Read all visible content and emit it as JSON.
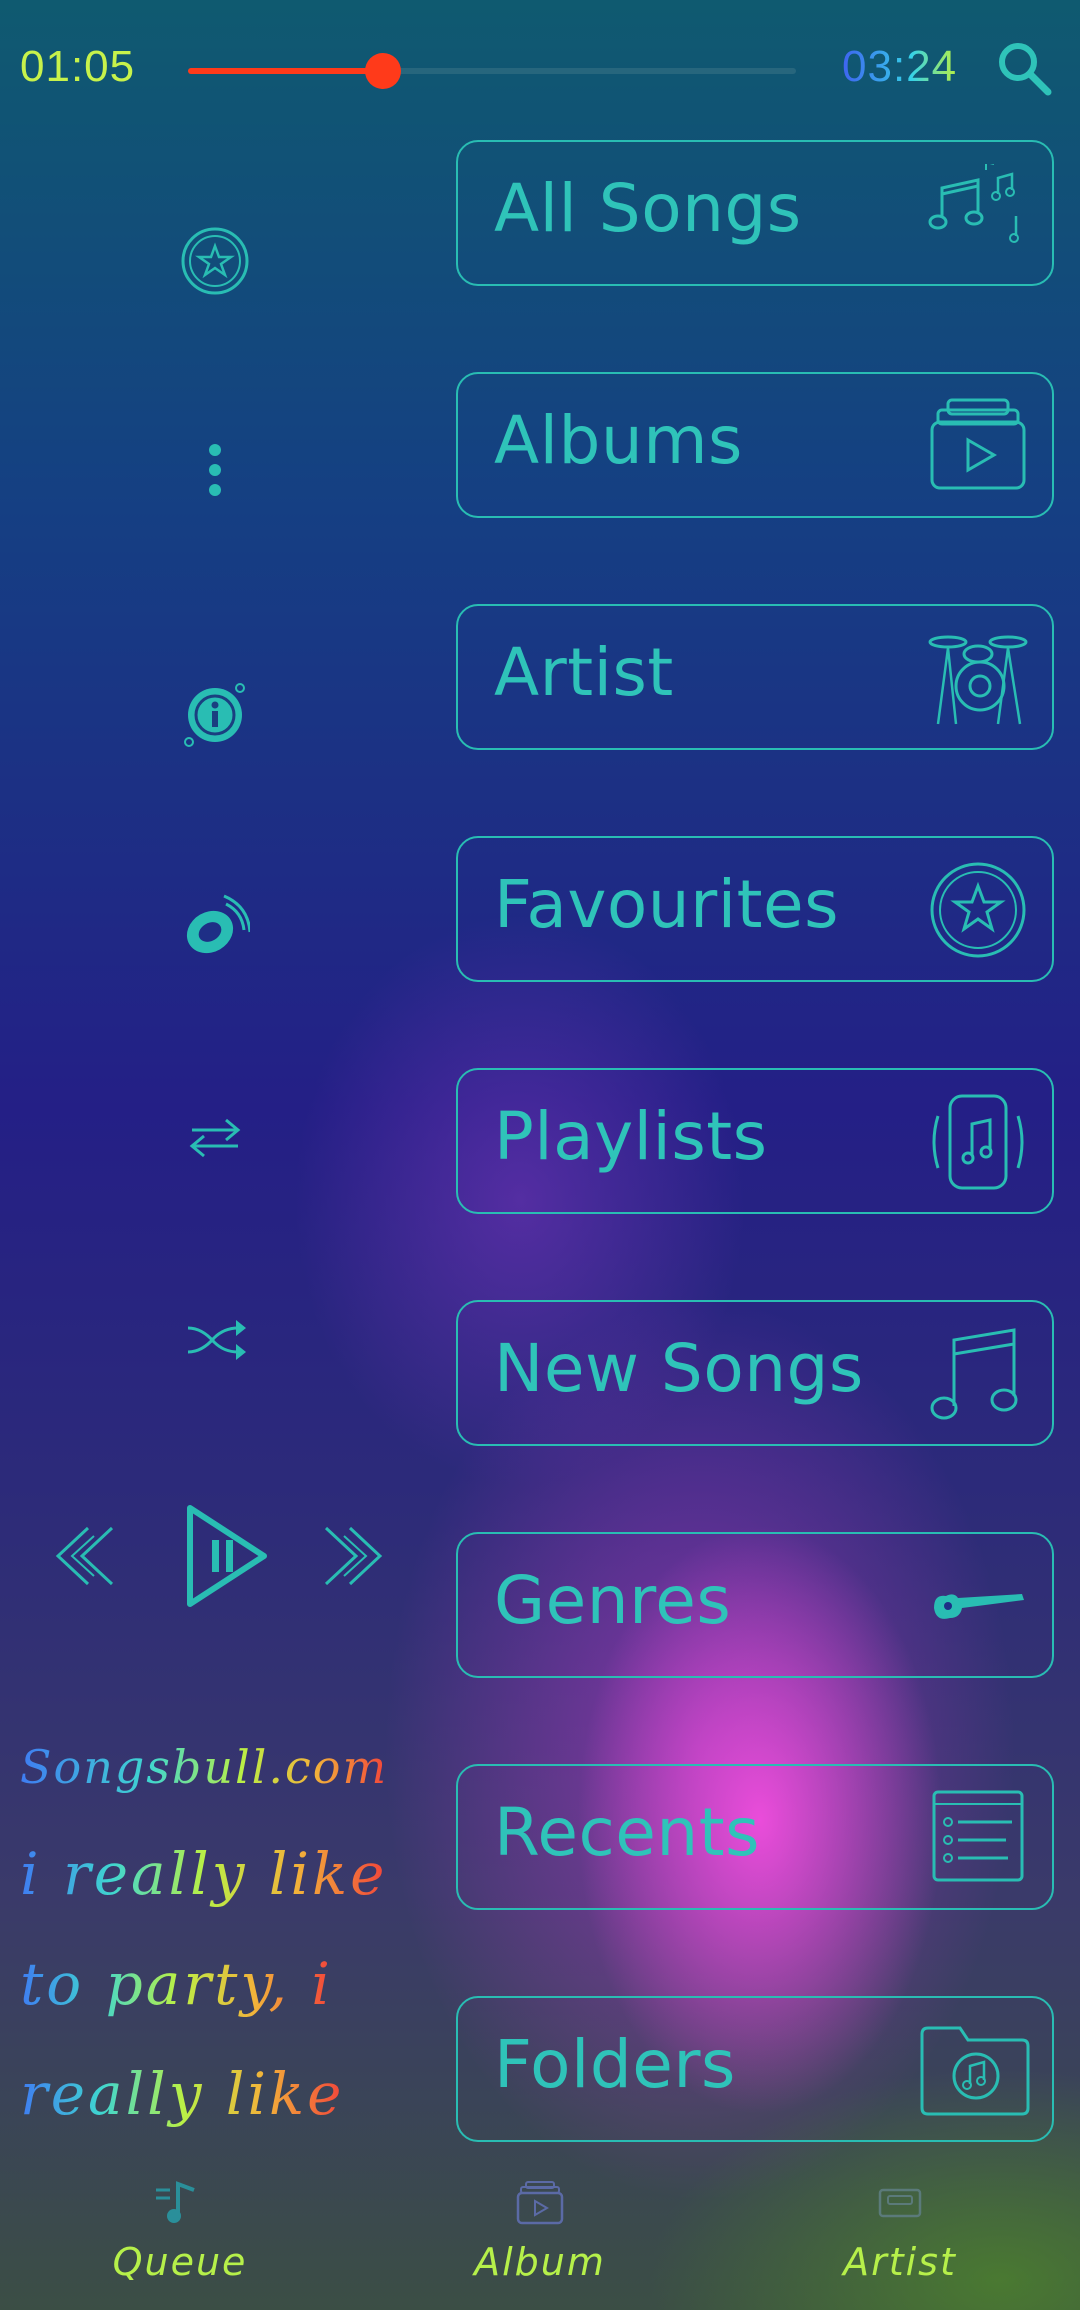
{
  "player": {
    "current_time": "01:05",
    "total_time": "03:24",
    "progress": 0.32
  },
  "menu": [
    {
      "label": "All Songs",
      "icon": "music-notes-icon"
    },
    {
      "label": "Albums",
      "icon": "album-stack-icon"
    },
    {
      "label": "Artist",
      "icon": "drum-kit-icon"
    },
    {
      "label": "Favourites",
      "icon": "star-circle-icon"
    },
    {
      "label": "Playlists",
      "icon": "phone-music-icon"
    },
    {
      "label": "New Songs",
      "icon": "music-note-icon"
    },
    {
      "label": "Genres",
      "icon": "guitar-icon"
    },
    {
      "label": "Recents",
      "icon": "recent-list-icon"
    },
    {
      "label": "Folders",
      "icon": "music-folder-icon"
    }
  ],
  "lyrics": {
    "brand": "Songsbull.com",
    "lines": [
      "i really like",
      "to party, i",
      "really like"
    ]
  },
  "tabs": [
    {
      "label": "Queue",
      "icon": "queue-icon"
    },
    {
      "label": "Album",
      "icon": "album-icon"
    },
    {
      "label": "Artist",
      "icon": "cassette-icon"
    }
  ],
  "colors": {
    "accent": "#2fc3b9",
    "progress": "#ff3a1a",
    "tab_label": "#b6f04a"
  }
}
